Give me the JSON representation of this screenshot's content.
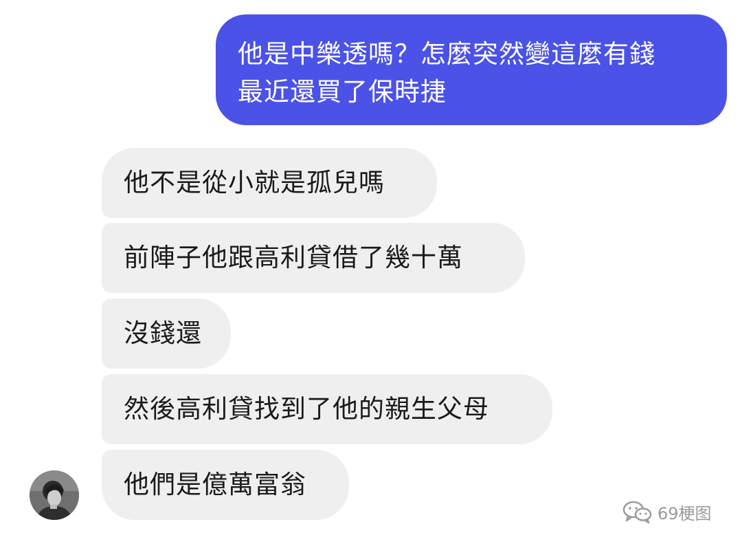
{
  "conversation": {
    "outgoing": {
      "lines": [
        "他是中樂透嗎？怎麼突然變這麼有錢",
        "最近還買了保時捷"
      ]
    },
    "incoming": [
      {
        "text": "他不是從小就是孤兒嗎"
      },
      {
        "text": "前陣子他跟高利貸借了幾十萬"
      },
      {
        "text": "沒錢還"
      },
      {
        "text": "然後高利貸找到了他的親生父母"
      },
      {
        "text": "他們是億萬富翁"
      }
    ]
  },
  "colors": {
    "outgoing_bubble": "#4b52e8",
    "incoming_bubble": "#efefef"
  },
  "watermark": {
    "icon": "wechat-icon",
    "text": "69梗图"
  },
  "avatar": {
    "icon": "user-avatar-photo"
  }
}
